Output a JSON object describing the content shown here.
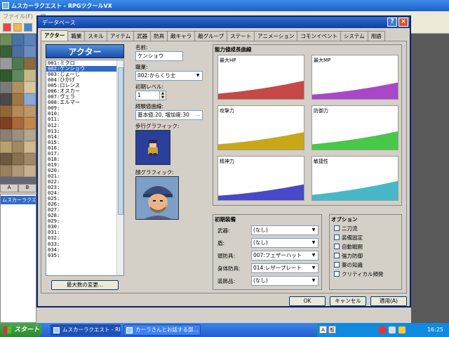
{
  "app": {
    "title": "ムスカーラクエスト - RPGツクールVX",
    "menu": [
      "ファイル(F)",
      "編"
    ],
    "tile_tabs": [
      "A",
      "B"
    ],
    "tree_item": "ムスカーラクエ"
  },
  "dialog": {
    "title": "データベース",
    "help": "?",
    "close": "×",
    "tabs": [
      "アクター",
      "職業",
      "スキル",
      "アイテム",
      "武器",
      "防具",
      "敵キャラ",
      "敵グループ",
      "ステート",
      "アニメーション",
      "コモンイベント",
      "システム",
      "用語"
    ],
    "active_tab": 0,
    "footer": {
      "ok": "OK",
      "cancel": "キャンセル",
      "apply": "適用(A)"
    }
  },
  "actors": {
    "header": "アクター",
    "items": [
      "001:ミクロ",
      "002:ケンショウ",
      "003:じょーじ",
      "004:ひかげ",
      "005:ロレンス",
      "006:オスカー",
      "007:ヴェラ",
      "008:エルマー",
      "009:",
      "010:",
      "011:",
      "012:",
      "013:",
      "014:",
      "015:",
      "016:",
      "017:",
      "018:",
      "019:",
      "020:",
      "021:",
      "022:",
      "023:",
      "024:",
      "025:",
      "026:",
      "027:",
      "028:",
      "029:",
      "030:",
      "031:",
      "032:",
      "033:",
      "034:",
      "035:"
    ],
    "selected": 1,
    "max_button": "最大数の変更..."
  },
  "detail": {
    "name_label": "名前:",
    "name_value": "ケンショウ",
    "class_label": "職業:",
    "class_value": "002:からくり士",
    "level_label": "初期レベル:",
    "level_value": "1",
    "exp_label": "経験値曲線:",
    "exp_value": "基本値:20, 増加度:30",
    "exp_button": "...",
    "walk_label": "歩行グラフィック:",
    "face_label": "顔グラフィック:"
  },
  "curves": {
    "title": "能力値成長曲線",
    "items": [
      {
        "label": "最大HP",
        "color": "#c84848",
        "start": 0.12,
        "end": 0.42
      },
      {
        "label": "最大MP",
        "color": "#a848c8",
        "start": 0.1,
        "end": 0.38
      },
      {
        "label": "攻撃力",
        "color": "#c8a818",
        "start": 0.12,
        "end": 0.4
      },
      {
        "label": "防御力",
        "color": "#48c848",
        "start": 0.12,
        "end": 0.42
      },
      {
        "label": "精神力",
        "color": "#4848c8",
        "start": 0.1,
        "end": 0.36
      },
      {
        "label": "敏捷性",
        "color": "#48b8c8",
        "start": 0.12,
        "end": 0.44
      }
    ]
  },
  "equipment": {
    "title": "初期装備",
    "rows": [
      {
        "label": "武器:",
        "value": "(なし)"
      },
      {
        "label": "盾:",
        "value": "(なし)"
      },
      {
        "label": "頭防具:",
        "value": "007:フェザーハット"
      },
      {
        "label": "身体防具:",
        "value": "014:レザープレート"
      },
      {
        "label": "装飾品:",
        "value": "(なし)"
      }
    ]
  },
  "options": {
    "title": "オプション",
    "items": [
      "二刀流",
      "装備固定",
      "自動戦闘",
      "強力防御",
      "薬の知識",
      "クリティカル頻発"
    ]
  },
  "taskbar": {
    "start": "スタート",
    "tasks": [
      "ムスカーラクエスト - RP...",
      "カーラさんとお話する部..."
    ],
    "clock": "16:25",
    "ime": [
      "A",
      "般"
    ]
  }
}
